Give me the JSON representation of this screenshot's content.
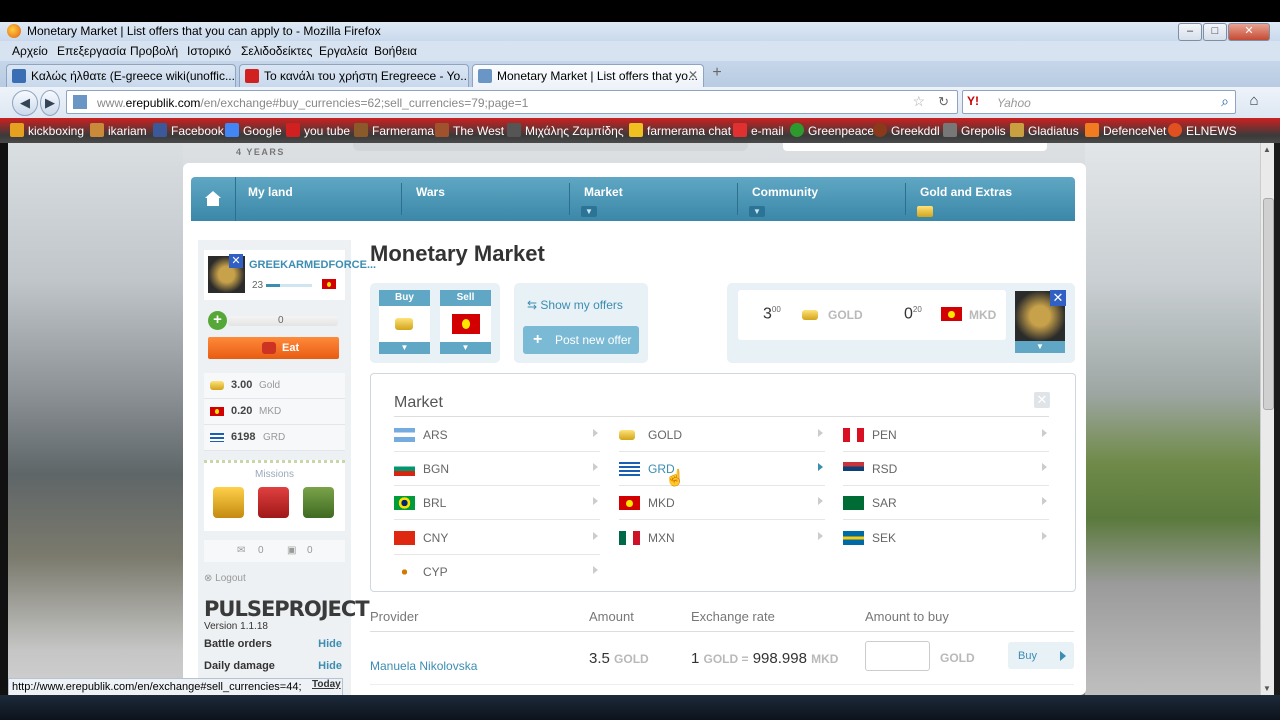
{
  "browser": {
    "window_title": "Monetary Market | List offers that you can apply to - Mozilla Firefox",
    "menu": [
      "Αρχείο",
      "Επεξεργασία",
      "Προβολή",
      "Ιστορικό",
      "Σελιδοδείκτες",
      "Εργαλεία",
      "Βοήθεια"
    ],
    "tabs": [
      {
        "label": "Καλώς ήλθατε (E-greece wiki(unoffic...",
        "active": false
      },
      {
        "label": "Το κανάλι του χρήστη Eregreece - Yo...",
        "active": false
      },
      {
        "label": "Monetary Market | List offers that yo...",
        "active": true
      }
    ],
    "url_prefix": "www.",
    "url_domain": "erepublik.com",
    "url_rest": "/en/exchange#buy_currencies=62;sell_currencies=79;page=1",
    "search_placeholder": "Yahoo",
    "search_engine": "Y!",
    "bookmarks": [
      "kickboxing",
      "ikariam",
      "Facebook",
      "Google",
      "you tube",
      "Farmerama",
      "The West",
      "Μιχάλης Ζαμπίδης",
      "farmerama chat",
      "e-mail",
      "Greenpeace",
      "Greekddl",
      "Grepolis",
      "Gladiatus",
      "DefenceNet",
      "ELNEWS"
    ],
    "status_url": "http://www.erepublik.com/en/exchange#sell_currencies=44;"
  },
  "page": {
    "years_badge": "4 YEARS",
    "nav": [
      "My land",
      "Wars",
      "Market",
      "Community",
      "Gold and Extras"
    ],
    "title": "Monetary Market",
    "colors": {
      "accent": "#3c8db2",
      "nav_bg": "#4a97b8",
      "eat": "#f07020"
    }
  },
  "sidebar": {
    "username": "GREEKARMEDFORCE...",
    "level": "23",
    "energy": "0",
    "eat_label": "Eat",
    "wallet": [
      {
        "value": "3.00",
        "currency": "Gold"
      },
      {
        "value": "0.20",
        "currency": "MKD"
      },
      {
        "value": "6198",
        "currency": "GRD"
      }
    ],
    "missions_label": "Missions",
    "messages": "0",
    "alerts": "0",
    "logout_label": "Logout",
    "pulse_title": "PULSEPROJECT",
    "pulse_version": "Version 1.1.18",
    "pulse_rows": [
      {
        "label": "Battle orders",
        "action": "Hide"
      },
      {
        "label": "Daily damage",
        "action": "Hide"
      }
    ],
    "today_label": "Today"
  },
  "exchange": {
    "buy_label": "Buy",
    "sell_label": "Sell",
    "show_offers": "Show my offers",
    "post_offer": "Post new offer",
    "balance": [
      {
        "int": "3",
        "dec": "00",
        "currency": "GOLD"
      },
      {
        "int": "0",
        "dec": "20",
        "currency": "MKD"
      }
    ]
  },
  "market": {
    "title": "Market",
    "currencies": [
      {
        "code": "ARS",
        "flag": "ar"
      },
      {
        "code": "BGN",
        "flag": "bg"
      },
      {
        "code": "BRL",
        "flag": "br"
      },
      {
        "code": "CNY",
        "flag": "cn"
      },
      {
        "code": "CYP",
        "flag": "cy"
      },
      {
        "code": "GOLD",
        "flag": "gold"
      },
      {
        "code": "GRD",
        "flag": "gr"
      },
      {
        "code": "MKD",
        "flag": "mk"
      },
      {
        "code": "MXN",
        "flag": "mx"
      },
      {
        "code": "PEN",
        "flag": "pe"
      },
      {
        "code": "RSD",
        "flag": "rs"
      },
      {
        "code": "SAR",
        "flag": "sa"
      },
      {
        "code": "SEK",
        "flag": "se"
      }
    ],
    "highlighted": "GRD"
  },
  "offers": {
    "columns": [
      "Provider",
      "Amount",
      "Exchange rate",
      "Amount to buy"
    ],
    "rows": [
      {
        "provider": "Manuela Nikolovska",
        "amount": "3.5",
        "amount_currency": "GOLD",
        "rate_left": "1",
        "rate_left_currency": "GOLD =",
        "rate_right": "998.998",
        "rate_right_currency": "MKD",
        "buy_currency": "GOLD",
        "buy_label": "Buy"
      }
    ]
  }
}
